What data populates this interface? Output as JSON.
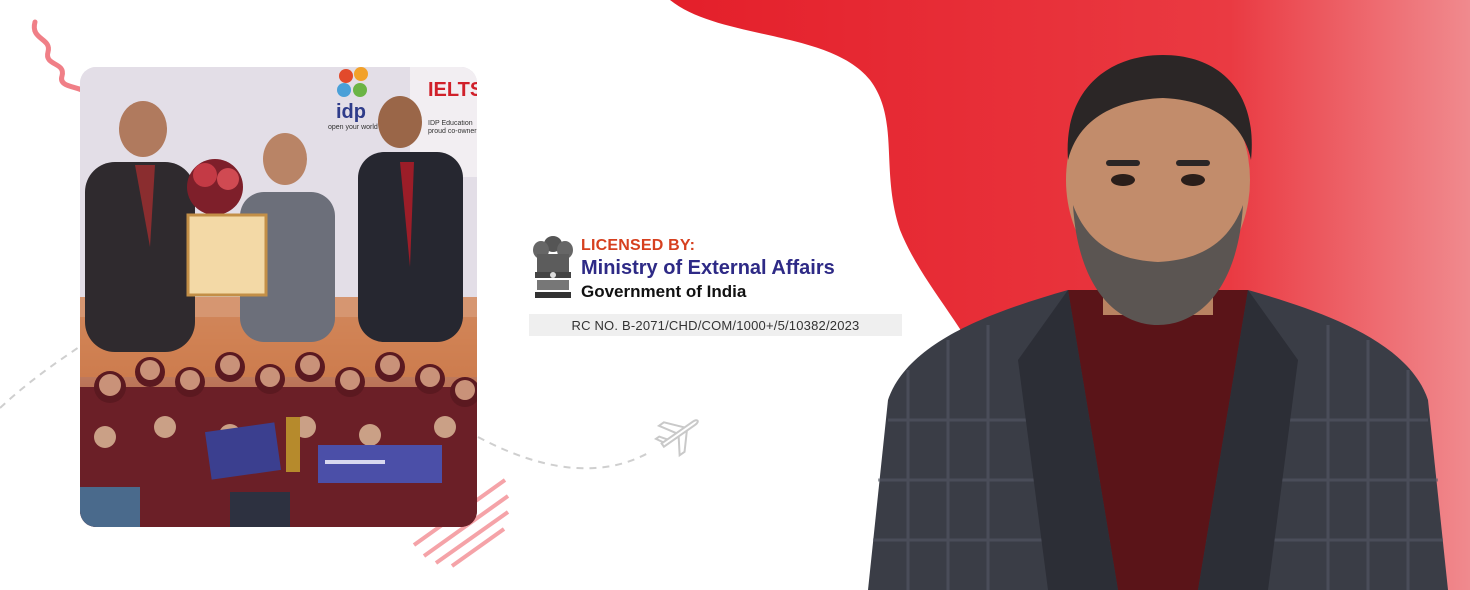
{
  "colors": {
    "accent_red": "#e8232f",
    "ministry_blue": "#2e2a86",
    "licensed_orange": "#d6401f"
  },
  "collage": {
    "sponsor_logo_text": "idp",
    "sponsor_tagline": "open your world",
    "exam_logo_text": "IELTS",
    "exam_tagline": "IDP Education proud co-owner"
  },
  "license": {
    "emblem_icon": "national-emblem-icon",
    "title": "LICENSED BY:",
    "ministry": "Ministry of External Affairs",
    "government": "Government of India",
    "rc_number": "RC NO. B-2071/CHD/COM/1000+/5/10382/2023"
  },
  "decorations": {
    "plane_icon": "airplane-icon",
    "squiggle_icon": "squiggle-icon"
  }
}
